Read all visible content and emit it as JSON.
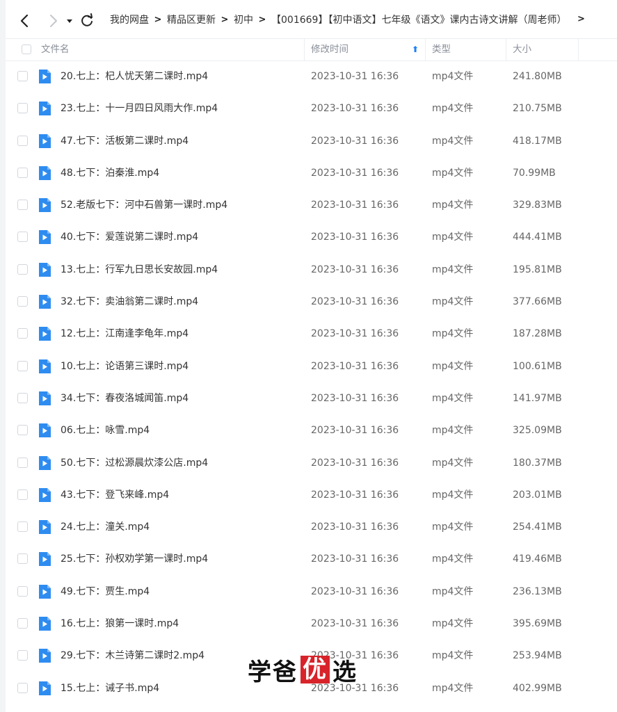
{
  "breadcrumb": {
    "items": [
      "我的网盘",
      "精品区更新",
      "初中",
      "【001669】【初中语文】七年级《语文》课内古诗文讲解（周老师）"
    ],
    "separator": ">",
    "more": ">"
  },
  "columns": {
    "name": "文件名",
    "modified": "修改时间",
    "modified_sort": "⬆",
    "type": "类型",
    "size": "大小"
  },
  "files": [
    {
      "name": "20.七上：杞人忧天第二课时.mp4",
      "time": "2023-10-31 16:36",
      "type": "mp4文件",
      "size": "241.80MB"
    },
    {
      "name": "23.七上：十一月四日风雨大作.mp4",
      "time": "2023-10-31 16:36",
      "type": "mp4文件",
      "size": "210.75MB"
    },
    {
      "name": "47.七下：活板第二课时.mp4",
      "time": "2023-10-31 16:36",
      "type": "mp4文件",
      "size": "418.17MB"
    },
    {
      "name": "48.七下：泊秦淮.mp4",
      "time": "2023-10-31 16:36",
      "type": "mp4文件",
      "size": "70.99MB"
    },
    {
      "name": "52.老版七下：河中石兽第一课时.mp4",
      "time": "2023-10-31 16:36",
      "type": "mp4文件",
      "size": "329.83MB"
    },
    {
      "name": "40.七下：爱莲说第二课时.mp4",
      "time": "2023-10-31 16:36",
      "type": "mp4文件",
      "size": "444.41MB"
    },
    {
      "name": "13.七上：行军九日思长安故园.mp4",
      "time": "2023-10-31 16:36",
      "type": "mp4文件",
      "size": "195.81MB"
    },
    {
      "name": "32.七下：卖油翁第二课时.mp4",
      "time": "2023-10-31 16:36",
      "type": "mp4文件",
      "size": "377.66MB"
    },
    {
      "name": "12.七上：江南逢李龟年.mp4",
      "time": "2023-10-31 16:36",
      "type": "mp4文件",
      "size": "187.28MB"
    },
    {
      "name": "10.七上：论语第三课时.mp4",
      "time": "2023-10-31 16:36",
      "type": "mp4文件",
      "size": "100.61MB"
    },
    {
      "name": "34.七下：春夜洛城闻笛.mp4",
      "time": "2023-10-31 16:36",
      "type": "mp4文件",
      "size": "141.97MB"
    },
    {
      "name": "06.七上：咏雪.mp4",
      "time": "2023-10-31 16:36",
      "type": "mp4文件",
      "size": "325.09MB"
    },
    {
      "name": "50.七下：过松源晨炊漆公店.mp4",
      "time": "2023-10-31 16:36",
      "type": "mp4文件",
      "size": "180.37MB"
    },
    {
      "name": "43.七下：登飞来峰.mp4",
      "time": "2023-10-31 16:36",
      "type": "mp4文件",
      "size": "203.01MB"
    },
    {
      "name": "24.七上：潼关.mp4",
      "time": "2023-10-31 16:36",
      "type": "mp4文件",
      "size": "254.41MB"
    },
    {
      "name": "25.七下：孙权劝学第一课时.mp4",
      "time": "2023-10-31 16:36",
      "type": "mp4文件",
      "size": "419.46MB"
    },
    {
      "name": "49.七下：贾生.mp4",
      "time": "2023-10-31 16:36",
      "type": "mp4文件",
      "size": "236.13MB"
    },
    {
      "name": "16.七上：狼第一课时.mp4",
      "time": "2023-10-31 16:36",
      "type": "mp4文件",
      "size": "395.69MB"
    },
    {
      "name": "29.七下：木兰诗第二课时2.mp4",
      "time": "2023-10-31 16:36",
      "type": "mp4文件",
      "size": "253.94MB"
    },
    {
      "name": "15.七上：诫子书.mp4",
      "time": "2023-10-31 16:36",
      "type": "mp4文件",
      "size": "402.99MB"
    }
  ],
  "watermark": {
    "part1": "学爸",
    "highlight": "优",
    "part2": "选"
  },
  "colors": {
    "accent": "#1f80f5",
    "video_icon": "#2e8cf0",
    "watermark_red": "#d8232a"
  }
}
